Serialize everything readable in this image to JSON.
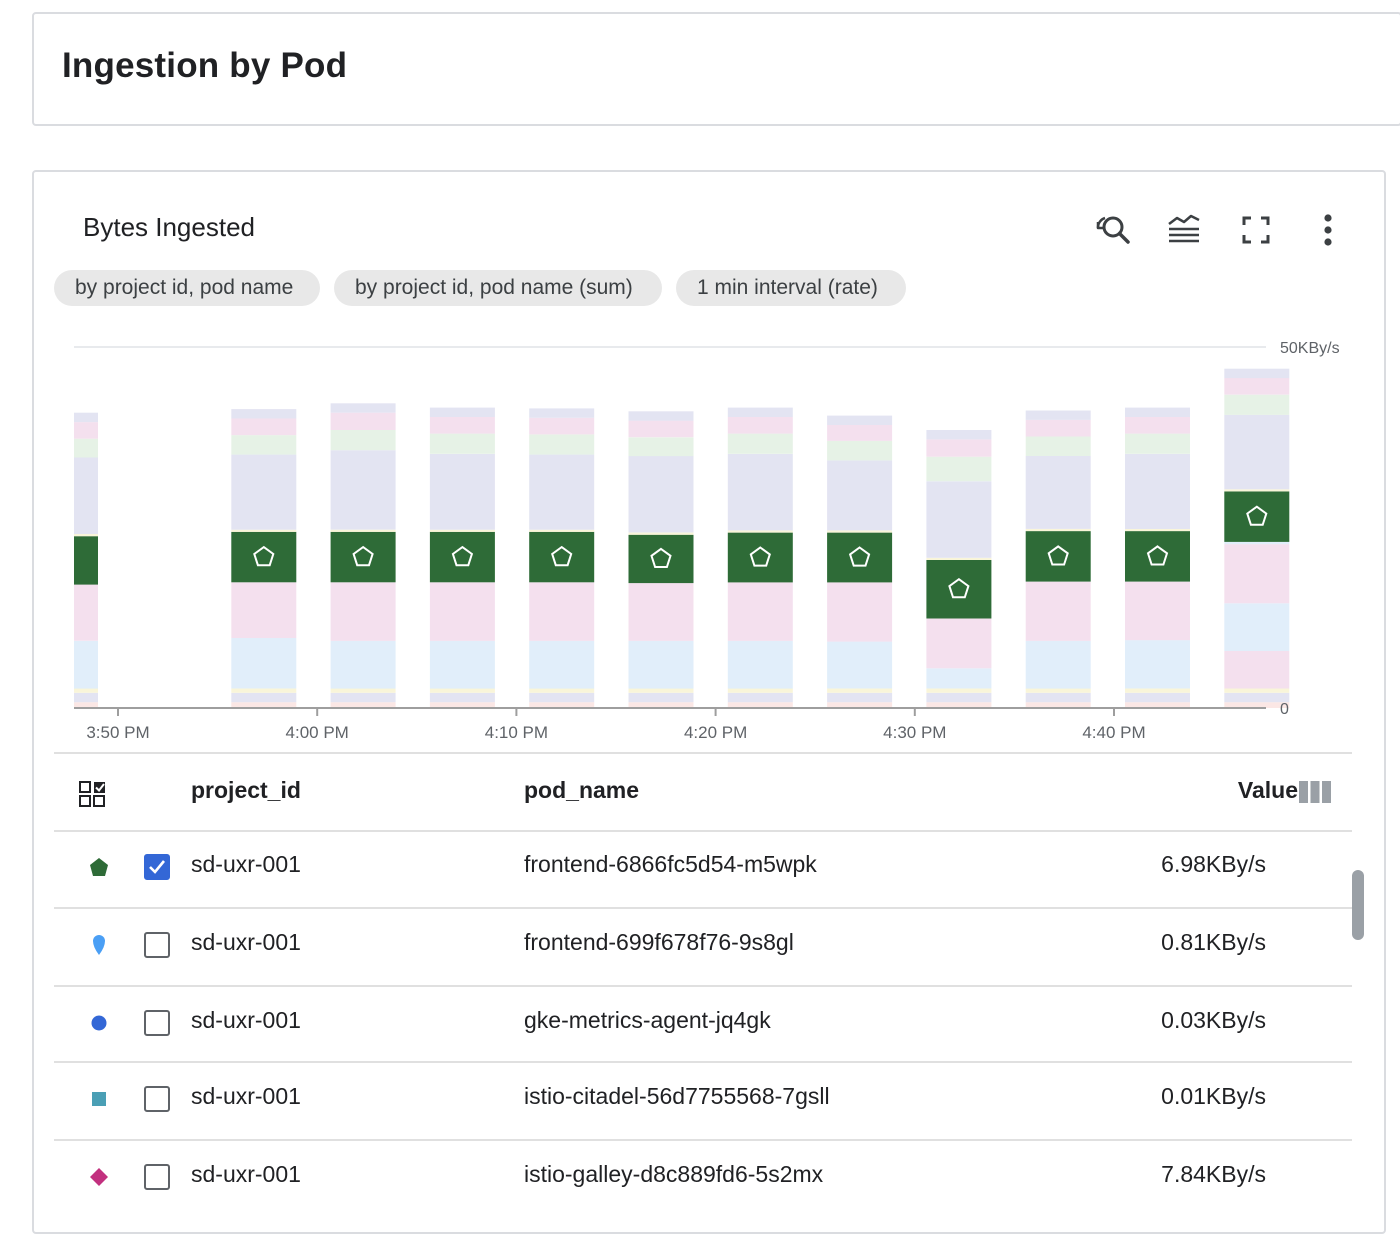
{
  "page": {
    "title": "Ingestion by Pod"
  },
  "chart_card": {
    "title": "Bytes Ingested",
    "toolbar": [
      "zoom-reset-icon",
      "legend-icon",
      "fullscreen-icon",
      "more-vert-icon"
    ],
    "chips": [
      "by project id, pod name",
      "by project id, pod name (sum)",
      "1 min interval (rate)"
    ]
  },
  "chart_data": {
    "type": "bar",
    "stacked": true,
    "y_unit": "KBy/s",
    "ylim": [
      0,
      50
    ],
    "y_tick_labels": [
      "50KBy/s",
      "0"
    ],
    "x_tick_labels": [
      "3:50 PM",
      "4:00 PM",
      "4:10 PM",
      "4:20 PM",
      "4:30 PM",
      "4:40 PM"
    ],
    "grid": true,
    "highlighted_series": "frontend-6866fc5d54-m5wpk",
    "colors": {
      "highlight": "#2e6b37",
      "light_blue": "#e1eefa",
      "pink": "#f4e0ee",
      "lavender": "#e3e4f2",
      "mint": "#e6f2e6",
      "peach": "#fbe7e5",
      "yellow": "#f9f5d9"
    },
    "bars": [
      {
        "segments": [
          {
            "c": "peach",
            "v": 0.8
          },
          {
            "c": "lavender",
            "v": 1.3
          },
          {
            "c": "yellow",
            "v": 0.6
          },
          {
            "c": "light_blue",
            "v": 6.6
          },
          {
            "c": "pink",
            "v": 7.8
          },
          {
            "c": "highlight",
            "v": 6.7
          },
          {
            "c": "yellow",
            "v": 0.3
          },
          {
            "c": "lavender",
            "v": 10.6
          },
          {
            "c": "mint",
            "v": 2.6
          },
          {
            "c": "pink",
            "v": 2.3
          },
          {
            "c": "lavender",
            "v": 1.3
          }
        ]
      },
      {
        "segments": [
          {
            "c": "peach",
            "v": 0.8
          },
          {
            "c": "lavender",
            "v": 1.3
          },
          {
            "c": "yellow",
            "v": 0.6
          },
          {
            "c": "light_blue",
            "v": 7.0
          },
          {
            "c": "pink",
            "v": 7.7
          },
          {
            "c": "highlight",
            "v": 7.0
          },
          {
            "c": "yellow",
            "v": 0.3
          },
          {
            "c": "lavender",
            "v": 10.4
          },
          {
            "c": "mint",
            "v": 2.7
          },
          {
            "c": "pink",
            "v": 2.3
          },
          {
            "c": "lavender",
            "v": 1.3
          }
        ]
      },
      {
        "segments": [
          {
            "c": "peach",
            "v": 0.8
          },
          {
            "c": "lavender",
            "v": 1.3
          },
          {
            "c": "yellow",
            "v": 0.6
          },
          {
            "c": "light_blue",
            "v": 6.6
          },
          {
            "c": "pink",
            "v": 8.1
          },
          {
            "c": "highlight",
            "v": 7.0
          },
          {
            "c": "yellow",
            "v": 0.3
          },
          {
            "c": "lavender",
            "v": 11.0
          },
          {
            "c": "mint",
            "v": 2.8
          },
          {
            "c": "pink",
            "v": 2.4
          },
          {
            "c": "lavender",
            "v": 1.3
          }
        ]
      },
      {
        "segments": [
          {
            "c": "peach",
            "v": 0.8
          },
          {
            "c": "lavender",
            "v": 1.3
          },
          {
            "c": "yellow",
            "v": 0.6
          },
          {
            "c": "light_blue",
            "v": 6.6
          },
          {
            "c": "pink",
            "v": 8.1
          },
          {
            "c": "highlight",
            "v": 7.0
          },
          {
            "c": "yellow",
            "v": 0.3
          },
          {
            "c": "lavender",
            "v": 10.5
          },
          {
            "c": "mint",
            "v": 2.8
          },
          {
            "c": "pink",
            "v": 2.3
          },
          {
            "c": "lavender",
            "v": 1.3
          }
        ]
      },
      {
        "segments": [
          {
            "c": "peach",
            "v": 0.8
          },
          {
            "c": "lavender",
            "v": 1.3
          },
          {
            "c": "yellow",
            "v": 0.6
          },
          {
            "c": "light_blue",
            "v": 6.6
          },
          {
            "c": "pink",
            "v": 8.1
          },
          {
            "c": "highlight",
            "v": 7.0
          },
          {
            "c": "yellow",
            "v": 0.3
          },
          {
            "c": "lavender",
            "v": 10.4
          },
          {
            "c": "mint",
            "v": 2.8
          },
          {
            "c": "pink",
            "v": 2.3
          },
          {
            "c": "lavender",
            "v": 1.3
          }
        ]
      },
      {
        "segments": [
          {
            "c": "peach",
            "v": 0.8
          },
          {
            "c": "lavender",
            "v": 1.3
          },
          {
            "c": "yellow",
            "v": 0.6
          },
          {
            "c": "light_blue",
            "v": 6.6
          },
          {
            "c": "pink",
            "v": 8.0
          },
          {
            "c": "highlight",
            "v": 6.7
          },
          {
            "c": "yellow",
            "v": 0.3
          },
          {
            "c": "lavender",
            "v": 10.6
          },
          {
            "c": "mint",
            "v": 2.6
          },
          {
            "c": "pink",
            "v": 2.3
          },
          {
            "c": "lavender",
            "v": 1.3
          }
        ]
      },
      {
        "segments": [
          {
            "c": "peach",
            "v": 0.8
          },
          {
            "c": "lavender",
            "v": 1.3
          },
          {
            "c": "yellow",
            "v": 0.6
          },
          {
            "c": "light_blue",
            "v": 6.6
          },
          {
            "c": "pink",
            "v": 8.1
          },
          {
            "c": "highlight",
            "v": 6.9
          },
          {
            "c": "yellow",
            "v": 0.3
          },
          {
            "c": "lavender",
            "v": 10.6
          },
          {
            "c": "mint",
            "v": 2.8
          },
          {
            "c": "pink",
            "v": 2.3
          },
          {
            "c": "lavender",
            "v": 1.3
          }
        ]
      },
      {
        "segments": [
          {
            "c": "peach",
            "v": 0.8
          },
          {
            "c": "lavender",
            "v": 1.3
          },
          {
            "c": "yellow",
            "v": 0.6
          },
          {
            "c": "light_blue",
            "v": 6.5
          },
          {
            "c": "pink",
            "v": 8.2
          },
          {
            "c": "highlight",
            "v": 6.9
          },
          {
            "c": "yellow",
            "v": 0.3
          },
          {
            "c": "lavender",
            "v": 9.7
          },
          {
            "c": "mint",
            "v": 2.7
          },
          {
            "c": "pink",
            "v": 2.2
          },
          {
            "c": "lavender",
            "v": 1.3
          }
        ]
      },
      {
        "segments": [
          {
            "c": "peach",
            "v": 0.8
          },
          {
            "c": "lavender",
            "v": 1.3
          },
          {
            "c": "yellow",
            "v": 0.6
          },
          {
            "c": "light_blue",
            "v": 2.8
          },
          {
            "c": "pink",
            "v": 6.9
          },
          {
            "c": "highlight",
            "v": 8.1
          },
          {
            "c": "yellow",
            "v": 0.3
          },
          {
            "c": "lavender",
            "v": 10.6
          },
          {
            "c": "mint",
            "v": 3.4
          },
          {
            "c": "pink",
            "v": 2.4
          },
          {
            "c": "lavender",
            "v": 1.3
          }
        ]
      },
      {
        "segments": [
          {
            "c": "peach",
            "v": 0.8
          },
          {
            "c": "lavender",
            "v": 1.3
          },
          {
            "c": "yellow",
            "v": 0.6
          },
          {
            "c": "light_blue",
            "v": 6.6
          },
          {
            "c": "pink",
            "v": 8.2
          },
          {
            "c": "highlight",
            "v": 7.0
          },
          {
            "c": "yellow",
            "v": 0.3
          },
          {
            "c": "lavender",
            "v": 10.1
          },
          {
            "c": "mint",
            "v": 2.7
          },
          {
            "c": "pink",
            "v": 2.3
          },
          {
            "c": "lavender",
            "v": 1.3
          }
        ]
      },
      {
        "segments": [
          {
            "c": "peach",
            "v": 0.8
          },
          {
            "c": "lavender",
            "v": 1.3
          },
          {
            "c": "yellow",
            "v": 0.6
          },
          {
            "c": "light_blue",
            "v": 6.7
          },
          {
            "c": "pink",
            "v": 8.1
          },
          {
            "c": "highlight",
            "v": 7.0
          },
          {
            "c": "yellow",
            "v": 0.3
          },
          {
            "c": "lavender",
            "v": 10.4
          },
          {
            "c": "mint",
            "v": 2.8
          },
          {
            "c": "pink",
            "v": 2.3
          },
          {
            "c": "lavender",
            "v": 1.3
          }
        ]
      },
      {
        "segments": [
          {
            "c": "peach",
            "v": 0.8
          },
          {
            "c": "lavender",
            "v": 1.3
          },
          {
            "c": "yellow",
            "v": 0.6
          },
          {
            "c": "pink",
            "v": 5.2
          },
          {
            "c": "light_blue",
            "v": 6.6
          },
          {
            "c": "pink",
            "v": 8.2
          },
          {
            "c": "light_blue",
            "v": 0.3
          },
          {
            "c": "highlight",
            "v": 7.0
          },
          {
            "c": "yellow",
            "v": 0.3
          },
          {
            "c": "lavender",
            "v": 10.3
          },
          {
            "c": "mint",
            "v": 2.8
          },
          {
            "c": "pink",
            "v": 2.3
          },
          {
            "c": "lavender",
            "v": 1.3
          }
        ]
      }
    ]
  },
  "table": {
    "headers": {
      "project_id": "project_id",
      "pod_name": "pod_name",
      "value": "Value"
    },
    "rows": [
      {
        "marker": "pentagon",
        "marker_color": "#2e6b37",
        "checked": true,
        "project_id": "sd-uxr-001",
        "pod_name": "frontend-6866fc5d54-m5wpk",
        "value": "6.98KBy/s"
      },
      {
        "marker": "teardrop",
        "marker_color": "#4a9ff5",
        "checked": false,
        "project_id": "sd-uxr-001",
        "pod_name": "frontend-699f678f76-9s8gl",
        "value": "0.81KBy/s"
      },
      {
        "marker": "circle",
        "marker_color": "#3367d6",
        "checked": false,
        "project_id": "sd-uxr-001",
        "pod_name": "gke-metrics-agent-jq4gk",
        "value": "0.03KBy/s"
      },
      {
        "marker": "square",
        "marker_color": "#4a9fb5",
        "checked": false,
        "project_id": "sd-uxr-001",
        "pod_name": "istio-citadel-56d7755568-7gsll",
        "value": "0.01KBy/s"
      },
      {
        "marker": "diamond",
        "marker_color": "#c2307f",
        "checked": false,
        "project_id": "sd-uxr-001",
        "pod_name": "istio-galley-d8c889fd6-5s2mx",
        "value": "7.84KBy/s"
      }
    ]
  }
}
